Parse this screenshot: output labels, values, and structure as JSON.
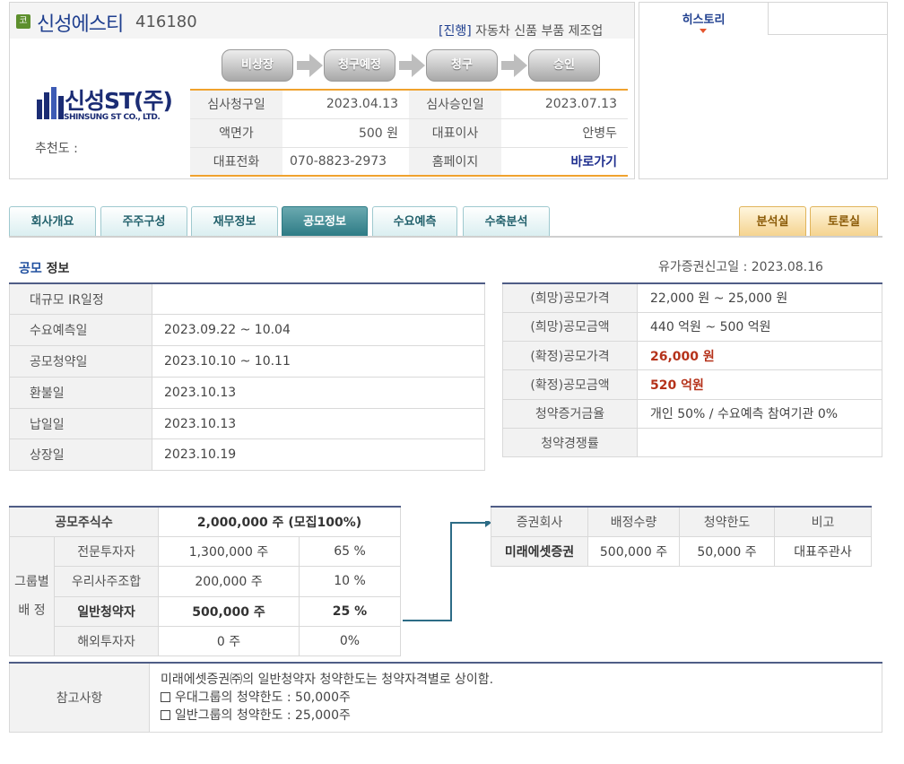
{
  "header": {
    "market_badge": "코",
    "company_name": "신성에스티",
    "stock_code": "416180",
    "status": "[진행]",
    "industry": "자동차 신품 부품 제조업",
    "logo_text_ko": "신성ST(주)",
    "logo_text_en": "SHINSUNG ST CO., LTD.",
    "recommend_label": "추천도 :"
  },
  "steps": [
    "비상장",
    "청구예정",
    "청구",
    "승인"
  ],
  "info": {
    "request_date_label": "심사청구일",
    "request_date": "2023.04.13",
    "approval_date_label": "심사승인일",
    "approval_date": "2023.07.13",
    "par_value_label": "액면가",
    "par_value": "500 원",
    "ceo_label": "대표이사",
    "ceo": "안병두",
    "phone_label": "대표전화",
    "phone": "070-8823-2973",
    "homepage_label": "홈페이지",
    "homepage_link": "바로가기"
  },
  "history": {
    "tab_label": "히스토리"
  },
  "tabs": [
    "회사개요",
    "주주구성",
    "재무정보",
    "공모정보",
    "수요예측",
    "수축분석"
  ],
  "right_tabs": [
    "분석실",
    "토론실"
  ],
  "section": {
    "title_hl": "공모",
    "title_rest": " 정보",
    "report_date": "유가증권신고일 : 2023.08.16"
  },
  "schedule": [
    {
      "label": "대규모 IR일정",
      "value": ""
    },
    {
      "label": "수요예측일",
      "value": "2023.09.22 ~ 10.04"
    },
    {
      "label": "공모청약일",
      "value": "2023.10.10 ~ 10.11"
    },
    {
      "label": "환불일",
      "value": "2023.10.13"
    },
    {
      "label": "납일일",
      "value": "2023.10.13"
    },
    {
      "label": "상장일",
      "value": "2023.10.19"
    }
  ],
  "pricing": [
    {
      "label": "(희망)공모가격",
      "value": "22,000 원 ~ 25,000 원"
    },
    {
      "label": "(희망)공모금액",
      "value": "440 억원  ~ 500 억원"
    },
    {
      "label": "(확정)공모가격",
      "value": "26,000 원"
    },
    {
      "label": "(확정)공모금액",
      "value": "520 억원"
    },
    {
      "label": "청약증거금율",
      "value": "개인 50% / 수요예측 참여기관 0%"
    },
    {
      "label": "청약경쟁률",
      "value": ""
    }
  ],
  "allocation": {
    "total_label": "공모주식수",
    "total_value": "2,000,000 주 (모집100%)",
    "group_label_1": "그룹별",
    "group_label_2": "배 정",
    "rows": [
      {
        "label": "전문투자자",
        "shares": "1,300,000 주",
        "pct": "65 %"
      },
      {
        "label": "우리사주조합",
        "shares": "200,000 주",
        "pct": "10 %"
      },
      {
        "label": "일반청약자",
        "shares": "500,000 주",
        "pct": "25 %"
      },
      {
        "label": "해외투자자",
        "shares": "0 주",
        "pct": "0%"
      }
    ]
  },
  "broker": {
    "headers": [
      "증권회사",
      "배정수량",
      "청약한도",
      "비고"
    ],
    "row": [
      "미래에셋증권",
      "500,000 주",
      "50,000 주",
      "대표주관사"
    ]
  },
  "notes": {
    "label": "참고사항",
    "line1": "미래에셋증권㈜의 일반청약자 청약한도는 청약자격별로 상이함.",
    "line2": "우대그룹의 청약한도 : 50,000주",
    "line3": "일반그룹의 청약한도 : 25,000주"
  },
  "colors": {
    "accent_orange": "#f0a22e",
    "teal_active": "#2c7a84",
    "navy_border": "#4f5d86",
    "red_value": "#b5321a"
  }
}
